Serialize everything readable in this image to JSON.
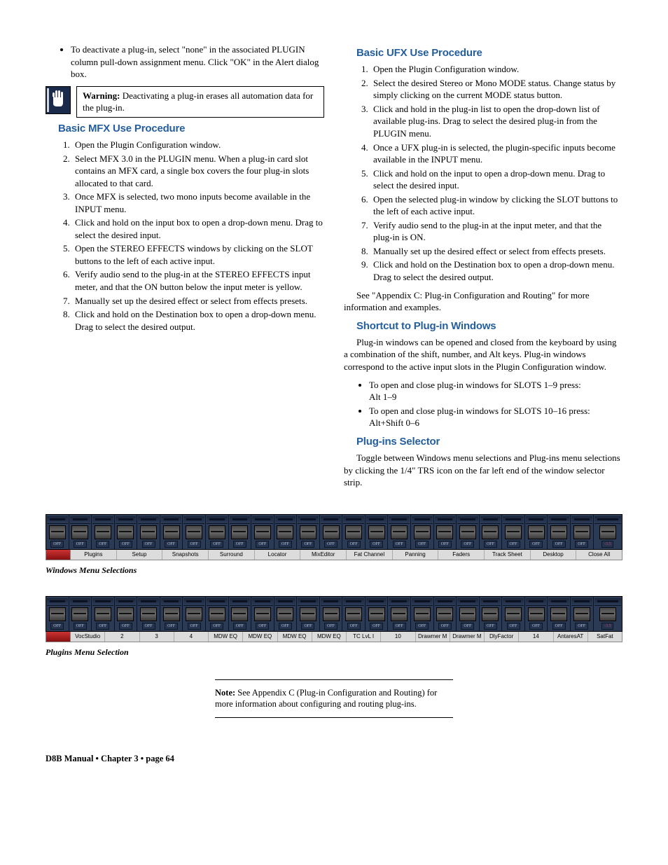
{
  "leftCol": {
    "bullet1": "To deactivate a plug-in, select \"none\" in the associated PLUGIN column pull-down assignment menu. Click \"OK\" in the Alert dialog box.",
    "warningLabel": "Warning:",
    "warningText": " Deactivating a plug-in erases all automation data for the plug-in.",
    "mfxHeading": "Basic MFX Use Procedure",
    "mfxSteps": [
      "Open the Plugin Configuration window.",
      "Select MFX 3.0 in the PLUGIN menu. When a plug-in card slot contains an MFX card, a single box covers the four plug-in slots allocated to that card.",
      "Once MFX is selected, two mono inputs become available in the INPUT menu.",
      "Click and hold on the input box to open a drop-down menu. Drag to select the desired input.",
      "Open the STEREO EFFECTS windows by clicking on the SLOT buttons to the left of each active input.",
      "Verify audio send to the plug-in at the STEREO EFFECTS input meter, and that the ON button below the input meter is yellow.",
      "Manually set up the desired effect or select from effects presets.",
      "Click and hold on the Destination box to open a drop-down menu. Drag to select the desired output."
    ]
  },
  "rightCol": {
    "ufxHeading": "Basic UFX Use Procedure",
    "ufxSteps": [
      "Open the Plugin Configuration window.",
      "Select the desired Stereo or Mono MODE status. Change status by simply clicking on the current MODE status button.",
      "Click and hold in the plug-in list to open the drop-down list of available plug-ins. Drag to select the desired plug-in from the PLUGIN menu.",
      "Once a UFX plug-in is selected, the plugin-specific inputs become available in the INPUT menu.",
      "Click and hold on the input to open a drop-down menu. Drag to select the desired input.",
      "Open the selected plug-in window by clicking the SLOT buttons to the left of each active input.",
      "Verify audio send to the plug-in at the input meter, and that the plug-in is ON.",
      "Manually set up the desired effect or select from effects presets.",
      "Click and hold on the Destination box to open a drop-down menu. Drag to select the desired output."
    ],
    "seeAppendix": "See \"Appendix C: Plug-in Configuration and Routing\" for more information and examples.",
    "shortcutHeading": "Shortcut to Plug-in Windows",
    "shortcutPara": "Plug-in windows can be opened and closed from the keyboard by using a combination of the shift, number, and Alt keys. Plug-in windows correspond to the active input slots in the Plugin Configuration window.",
    "shortcutBullets": [
      "To open and close plug-in windows for SLOTS 1–9 press:\nAlt 1–9",
      "To open and close plug-in windows for SLOTS 10–16 press: Alt+Shift 0–6"
    ],
    "selectorHeading": "Plug-ins Selector",
    "selectorPara": "Toggle between Windows menu selections and Plug-ins menu selections by clicking the 1/4\" TRS icon on the far left end of the window selector strip."
  },
  "offLabel": "OFF",
  "masterDb": "-3.5",
  "windowsLabels": [
    "Plugins",
    "Setup",
    "Snapshots",
    "Surround",
    "Locator",
    "MixEditor",
    "Fat Channel",
    "Panning",
    "Faders",
    "Track Sheet",
    "Desktop",
    "Close All"
  ],
  "windowsCaption": "Windows Menu Selections",
  "pluginsLabels": [
    "VocStudio",
    "2",
    "3",
    "4",
    "MDW EQ",
    "MDW EQ",
    "MDW EQ",
    "MDW EQ",
    "TC LvL I",
    "10",
    "Drawmer M",
    "Drawmer M",
    "DlyFactor",
    "14",
    "AntaresAT",
    "SatFat"
  ],
  "pluginsCaption": "Plugins Menu Selection",
  "noteLabel": "Note:",
  "noteText": " See Appendix C (Plug-in Configuration and Routing) for more information about configuring and routing plug-ins.",
  "footer": "D8B Manual • Chapter 3 • page  64"
}
